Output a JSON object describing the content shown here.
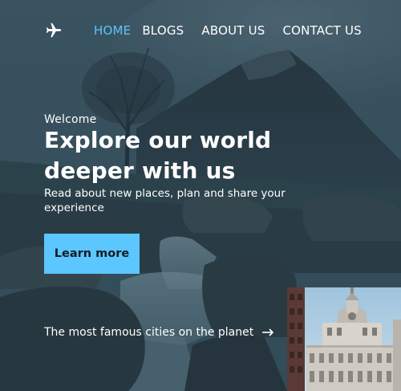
{
  "nav": {
    "logo_icon": "airplane-icon",
    "links": [
      {
        "label": "HOME",
        "active": true
      },
      {
        "label": "BLOGS",
        "active": false
      },
      {
        "label": "ABOUT US",
        "active": false
      },
      {
        "label": "CONTACT US",
        "active": false
      }
    ]
  },
  "hero": {
    "welcome": "Welcome",
    "headline": "Explore our world deeper with us",
    "subtitle": "Read about new places, plan and share your experience",
    "cta_label": "Learn more"
  },
  "cities": {
    "link_label": "The most famous cities on the planet",
    "arrow_icon": "arrow-right-icon"
  },
  "colors": {
    "accent": "#5cc6ff",
    "text": "#ffffff",
    "button_text": "#111c24"
  }
}
